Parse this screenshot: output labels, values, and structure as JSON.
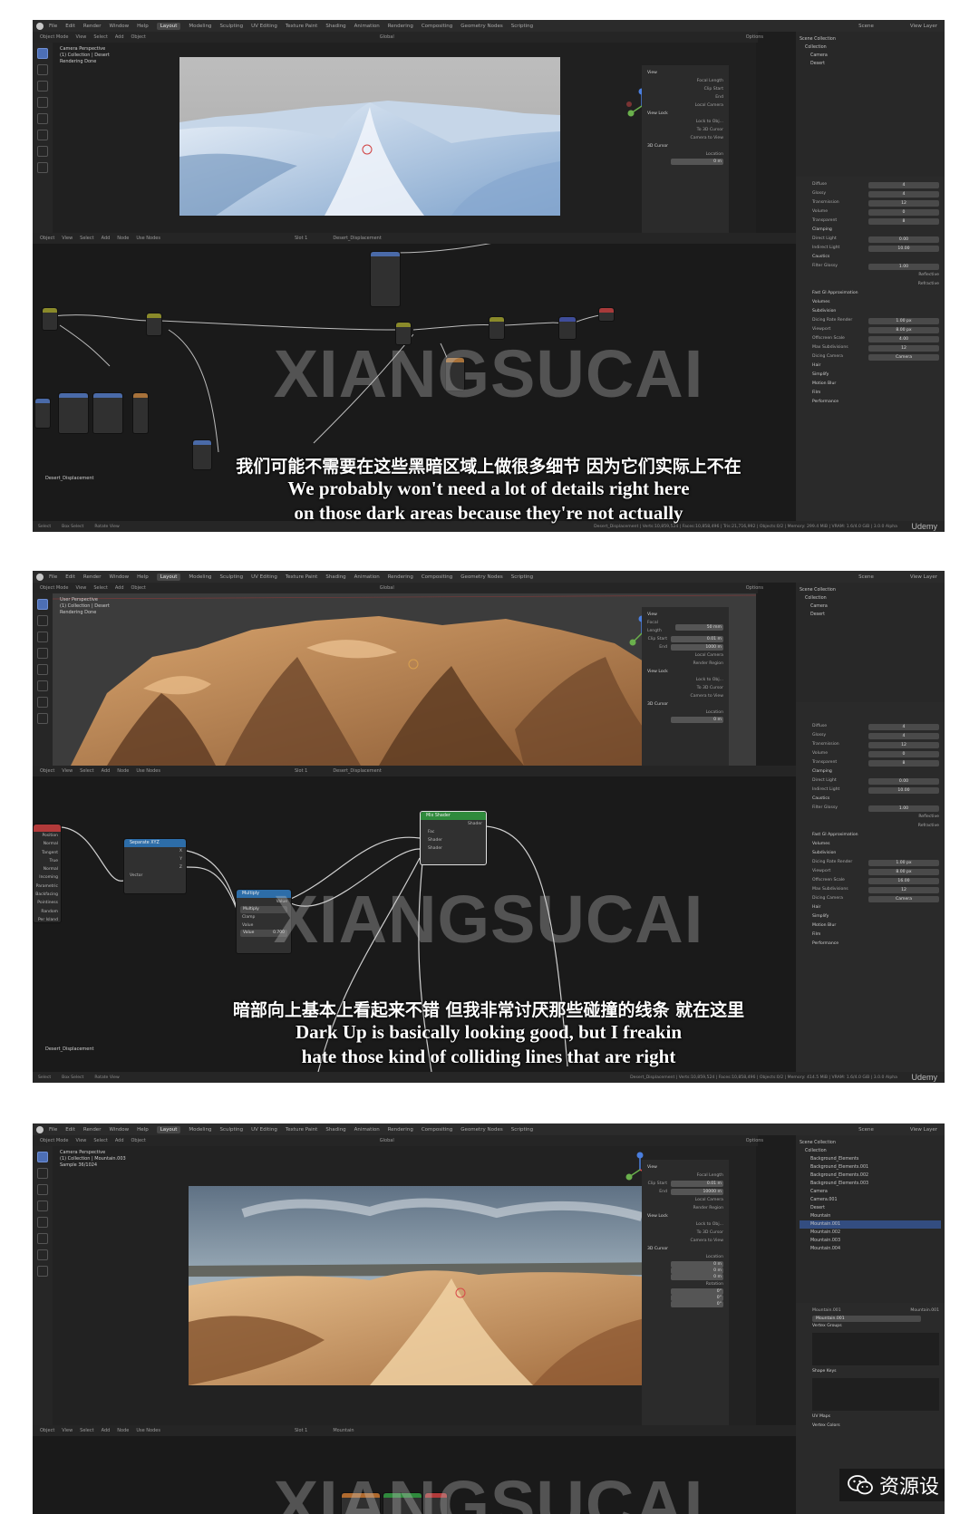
{
  "watermark": "XIANGSUCAI",
  "blender": {
    "menus": [
      "File",
      "Edit",
      "Render",
      "Window",
      "Help"
    ],
    "workspaces": [
      "Layout",
      "Modeling",
      "Sculpting",
      "UV Editing",
      "Texture Paint",
      "Shading",
      "Animation",
      "Rendering",
      "Compositing",
      "Geometry Nodes",
      "Scripting"
    ],
    "scene": "Scene",
    "view_layer": "View Layer",
    "mode": "Object Mode",
    "viewport_menu": [
      "View",
      "Select",
      "Add",
      "Object"
    ],
    "node_menu": [
      "Object",
      "View",
      "Select",
      "Add",
      "Node"
    ],
    "use_nodes": "Use Nodes",
    "slot": "Slot 1",
    "transform": "Global",
    "options": "Options",
    "udemy": "Udemy",
    "statusbar": [
      "Select",
      "Box Select",
      "Rotate View"
    ]
  },
  "npanel": {
    "view": "View",
    "focal_length": "Focal Length",
    "clip_start": "Clip Start",
    "end": "End",
    "local_camera": "Local Camera",
    "view_lock": "View Lock",
    "lock_to_object": "Lock to Obj...",
    "lock": "Lock",
    "to_3d_cursor": "To 3D Cursor",
    "camera_to_view": "Camera to View",
    "cursor": "3D Cursor",
    "location": "Location",
    "rotation": "Rotation",
    "render_region": "Render Region"
  },
  "props": {
    "diffuse": "Diffuse",
    "glossy": "Glossy",
    "transmission": "Transmission",
    "volume": "Volume",
    "transparent": "Transparent",
    "clamping": "Clamping",
    "direct_light": "Direct Light",
    "indirect_light": "Indirect Light",
    "caustics": "Caustics",
    "filter_glossy": "Filter Glossy",
    "reflective": "Reflective",
    "refractive": "Refractive",
    "fast_gi": "Fast GI Approximation",
    "volumes": "Volumes",
    "subdivision": "Subdivision",
    "dicing_rate_render": "Dicing Rate Render",
    "viewport": "Viewport",
    "offscreen_scale": "Offscreen Scale",
    "max_subdivisions": "Max Subdivisions",
    "dicing_camera": "Dicing Camera",
    "camera": "Camera",
    "hair": "Hair",
    "simplify": "Simplify",
    "motion_blur": "Motion Blur",
    "film": "Film",
    "performance": "Performance"
  },
  "panels": [
    {
      "overlay": [
        "Camera Perspective",
        "(1) Collection | Desert",
        "Rendering Done"
      ],
      "material": "Desert_Displacement",
      "node_label": "Desert_Displacement",
      "outliner": [
        "Scene Collection",
        "Collection",
        "Camera",
        "Desert"
      ],
      "values": {
        "focal": "50 mm",
        "clip_start": "0.01 m",
        "clip_end": "1000 m",
        "x": "0 m",
        "diffuse": "4",
        "glossy": "4",
        "transmission": "12",
        "volume": "0",
        "transparent": "8",
        "direct": "0.00",
        "indirect": "10.00",
        "filter_glossy": "1.00",
        "dicing_render": "1.00 px",
        "dicing_viewport": "8.00 px",
        "offscreen": "4.00",
        "max_sub": "12"
      },
      "statusbar_right": "Desert_Displacement | Verts:10,859,524 | Faces:10,858,496 | Tris:21,716,992 | Objects:0/2 | Memory: 299.4 MiB | VRAM: 1.6/4.0 GiB | 3.0.0 Alpha",
      "subtitle_cn": "我们可能不需要在这些黑暗区域上做很多细节 因为它们实际上不在",
      "subtitle_en": [
        "We probably won't need a lot of details right here",
        "on those dark areas because they're not actually"
      ]
    },
    {
      "overlay": [
        "User Perspective",
        "(1) Collection | Desert",
        "Rendering Done"
      ],
      "material": "Desert_Displacement",
      "node_label": "Desert_Displacement",
      "outliner": [
        "Scene Collection",
        "Collection",
        "Camera",
        "Desert"
      ],
      "nodes": {
        "separate": "Separate XYZ",
        "separate_out": [
          "X",
          "Y",
          "Z"
        ],
        "separate_in": "Vector",
        "multiply": "Multiply",
        "multiply_out": "Value",
        "multiply_op": "Multiply",
        "clamp": "Clamp",
        "value": "Value",
        "value2": "Value",
        "value2_num": "0.700",
        "mix": "Mix Shader",
        "mix_out": "Shader",
        "mix_in": [
          "Fac",
          "Shader",
          "Shader"
        ],
        "texcoord": [
          "Position",
          "Normal",
          "Tangent",
          "True Normal",
          "Incoming",
          "Parametric",
          "Backfacing",
          "Pointiness",
          "Random Per Island"
        ]
      },
      "values": {
        "focal": "50 mm",
        "clip_start": "0.01 m",
        "clip_end": "1000 m",
        "x": "0 m",
        "diffuse": "4",
        "glossy": "4",
        "transmission": "12",
        "volume": "0",
        "transparent": "8",
        "direct": "0.00",
        "indirect": "10.00",
        "filter_glossy": "1.00",
        "dicing_render": "1.00 px",
        "dicing_viewport": "8.00 px",
        "offscreen": "16.00",
        "max_sub": "12"
      },
      "statusbar_right": "Desert_Displacement | Verts:10,859,524 | Faces:10,858,496 | Objects:0/2 | Memory: 414.5 MiB | VRAM: 1.6/4.0 GiB | 3.0.0 Alpha",
      "subtitle_cn": "暗部向上基本上看起来不错 但我非常讨厌那些碰撞的线条 就在这里",
      "subtitle_en": [
        "Dark Up is basically looking good, but I freakin",
        "hate those kind of colliding lines that are right"
      ]
    },
    {
      "overlay": [
        "Camera Perspective",
        "(1) Collection | Mountain.003",
        "Sample 36/1024"
      ],
      "material": "Mountain",
      "outliner": [
        "Scene Collection",
        "Collection",
        "Background_Elements",
        "Background_Elements.001",
        "Background_Elements.002",
        "Background_Elements.003",
        "Camera",
        "Camera.001",
        "Desert",
        "Mountain",
        "Mountain.001",
        "Mountain.002",
        "Mountain.003",
        "Mountain.004"
      ],
      "selected_object": "Mountain.001",
      "mesh": "Mountain.001",
      "vertex_groups": "Vertex Groups",
      "shape_keys": "Shape Keys",
      "uv_maps": "UV Maps",
      "vertex_colors": "Vertex Colors",
      "values": {
        "clip_start": "0.01 m",
        "clip_end": "10000 m",
        "x": "0 m",
        "y": "0 m",
        "z": "0 m",
        "rx": "0°",
        "ry": "0°",
        "rz": "0°"
      }
    }
  ],
  "wechat": {
    "label": "资源设"
  },
  "colors": {
    "bg": "#1d1d1d",
    "accent": "#4d6fb5",
    "node_green": "#2f8a3c",
    "node_blue": "#2d6da8",
    "node_red": "#b23a3a"
  }
}
